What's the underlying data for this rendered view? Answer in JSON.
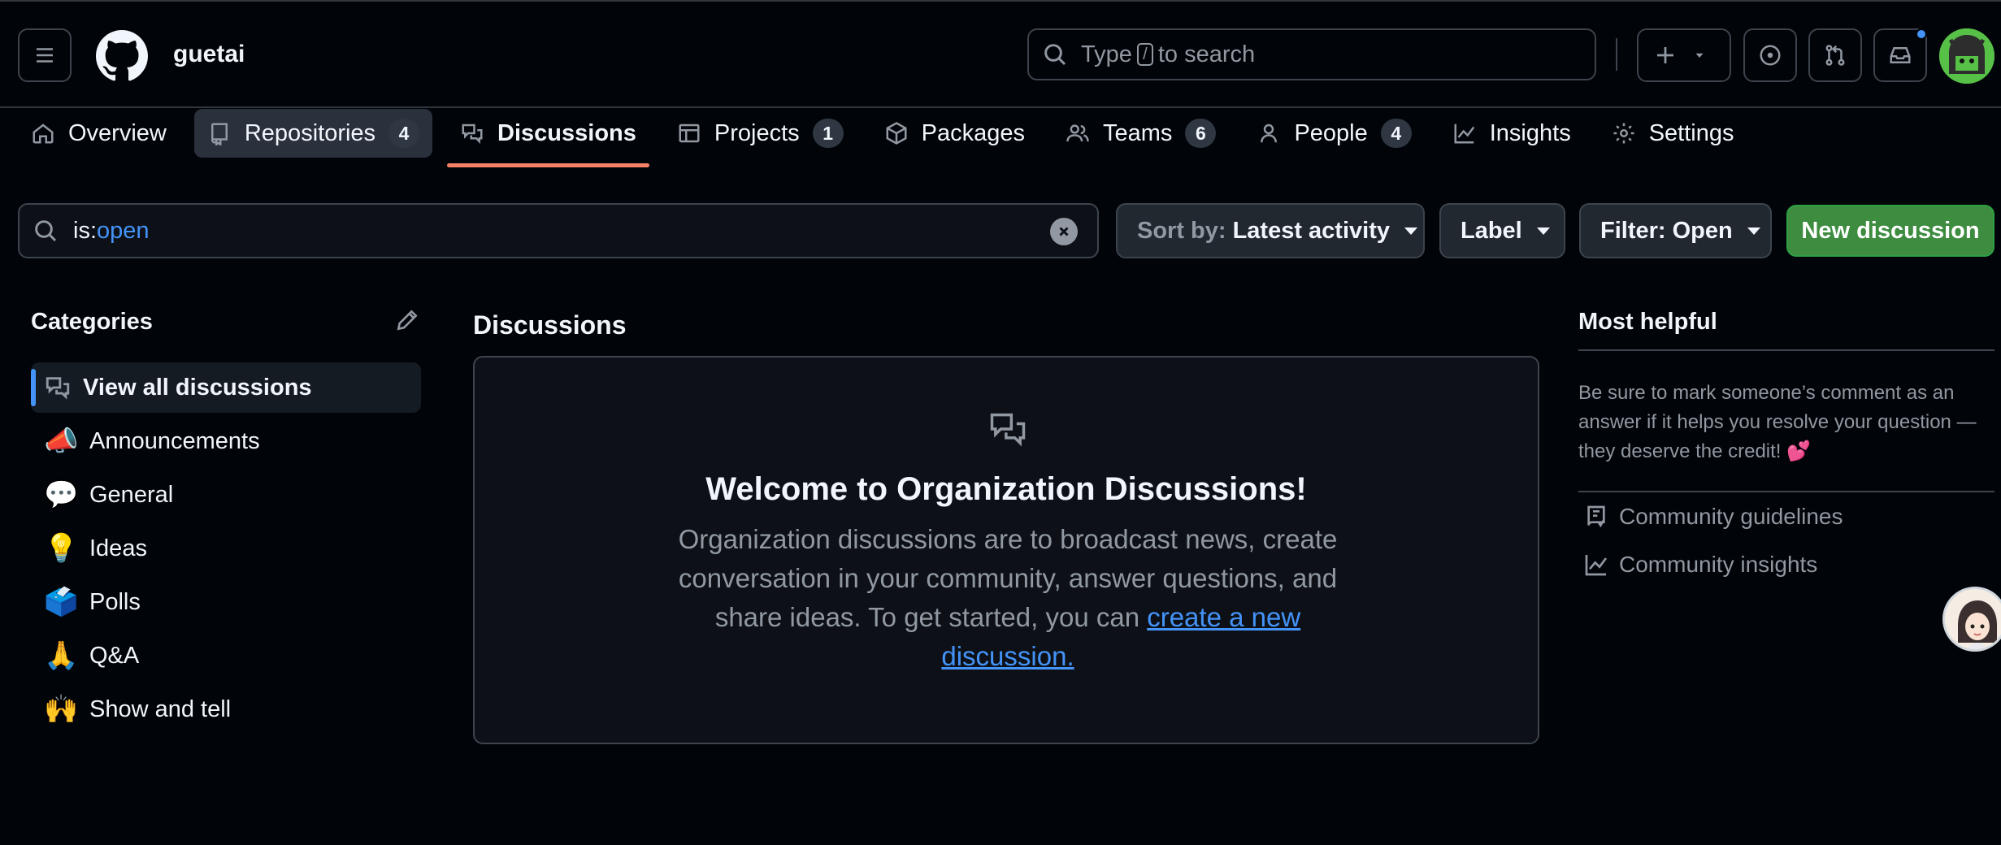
{
  "header": {
    "org_name": "guetai",
    "search_prefix": "Type",
    "search_key": "/",
    "search_suffix": "to search"
  },
  "nav": {
    "tabs": [
      {
        "label": "Overview",
        "icon": "home-icon"
      },
      {
        "label": "Repositories",
        "icon": "repo-icon",
        "count": "4"
      },
      {
        "label": "Discussions",
        "icon": "comment-discussion-icon"
      },
      {
        "label": "Projects",
        "icon": "table-icon",
        "count": "1"
      },
      {
        "label": "Packages",
        "icon": "package-icon"
      },
      {
        "label": "Teams",
        "icon": "people-icon",
        "count": "6"
      },
      {
        "label": "People",
        "icon": "person-icon",
        "count": "4"
      },
      {
        "label": "Insights",
        "icon": "graph-icon"
      },
      {
        "label": "Settings",
        "icon": "gear-icon"
      }
    ]
  },
  "filter": {
    "keyword": "is:",
    "value": "open",
    "sort_label": "Sort by:",
    "sort_value": "Latest activity",
    "label_button": "Label",
    "filter_button": "Filter: Open",
    "new_button": "New discussion"
  },
  "categories": {
    "title": "Categories",
    "items": [
      {
        "label": "View all discussions",
        "icon": "comment-discussion-icon"
      },
      {
        "label": "Announcements",
        "emoji": "📣"
      },
      {
        "label": "General",
        "emoji": "💬"
      },
      {
        "label": "Ideas",
        "emoji": "💡"
      },
      {
        "label": "Polls",
        "emoji": "🗳️"
      },
      {
        "label": "Q&A",
        "emoji": "🙏"
      },
      {
        "label": "Show and tell",
        "emoji": "🙌"
      }
    ]
  },
  "main": {
    "title": "Discussions",
    "empty_heading": "Welcome to Organization Discussions!",
    "empty_body": "Organization discussions are to broadcast news, create conversation in your community, answer questions, and share ideas. To get started, you can",
    "empty_link": "create a new discussion."
  },
  "sidebar_right": {
    "title": "Most helpful",
    "text": "Be sure to mark someone’s comment as an answer if it helps you resolve your question — they deserve the credit! 💕",
    "links": [
      {
        "label": "Community guidelines",
        "icon": "book-icon"
      },
      {
        "label": "Community insights",
        "icon": "graph-icon"
      }
    ]
  },
  "colors": {
    "background": "#010409",
    "accent_tab": "#f78166",
    "link": "#4493f8",
    "primary_button": "#3d8c40"
  }
}
